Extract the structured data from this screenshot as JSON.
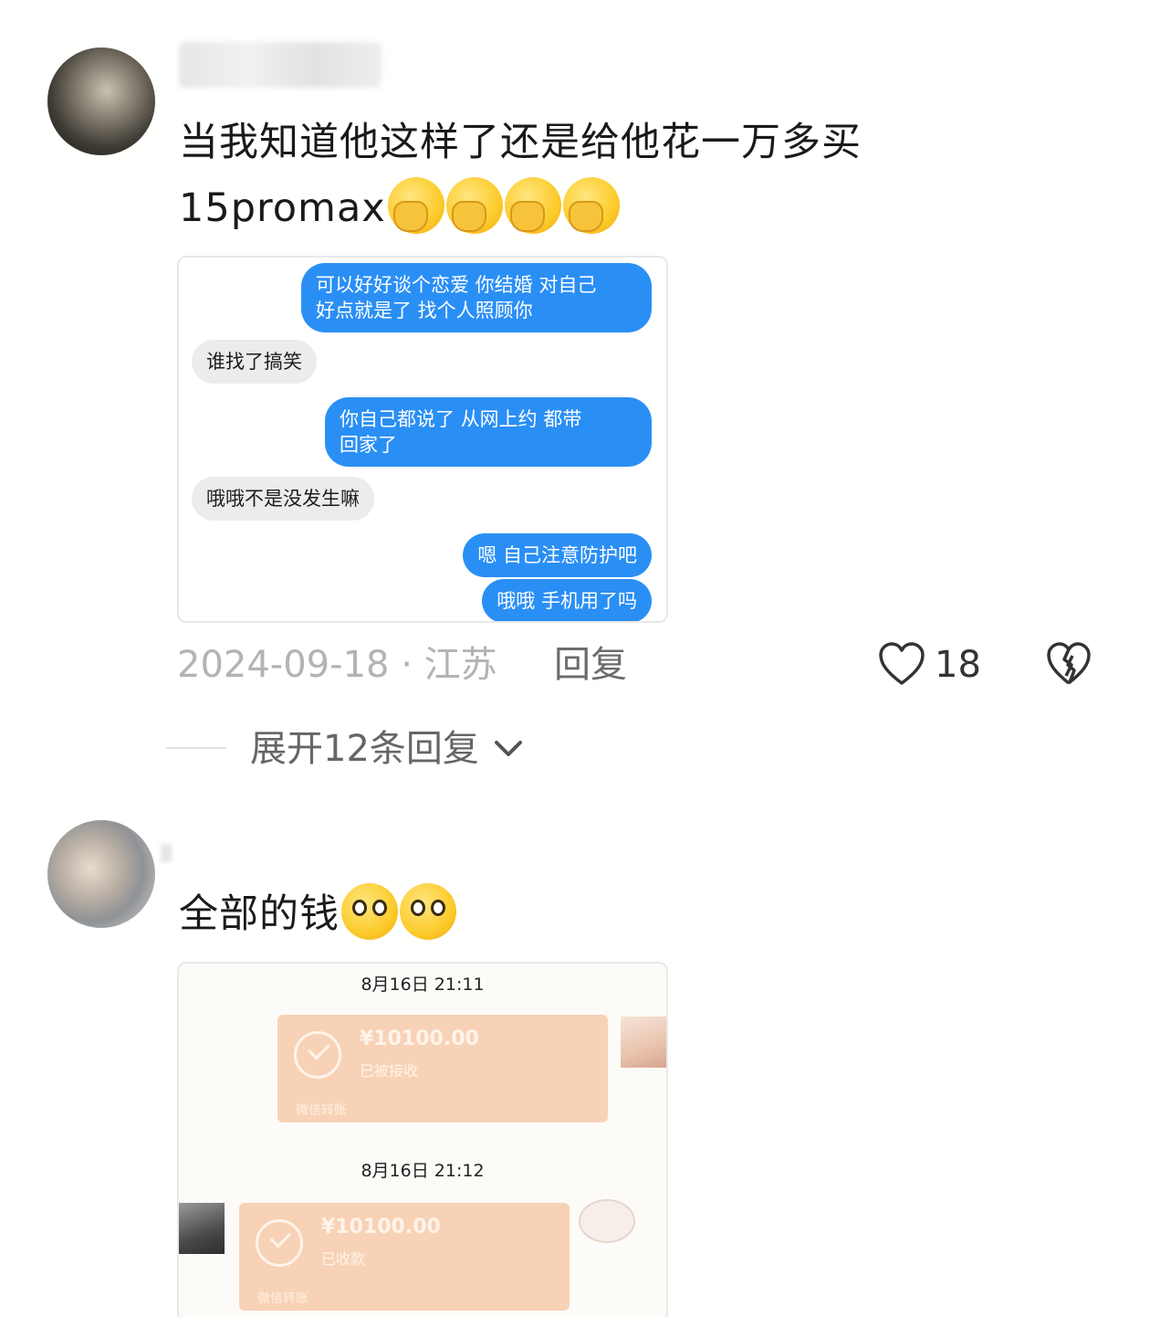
{
  "comments": [
    {
      "text_line1": "当我知道他这样了还是给他花一万多买",
      "text_line2": "15promax",
      "emoji_count": 4,
      "emoji_name": "facepalm-emoji",
      "chat": [
        {
          "side": "me",
          "text": "可以好好谈个恋爱 你结婚 对自己\n好点就是了 找个人照顾你"
        },
        {
          "side": "them",
          "text": "谁找了搞笑"
        },
        {
          "side": "me",
          "text": "你自己都说了 从网上约 都带\n回家了"
        },
        {
          "side": "them",
          "text": "哦哦不是没发生嘛"
        },
        {
          "side": "me",
          "text": "嗯 自己注意防护吧"
        },
        {
          "side": "me",
          "text": "哦哦 手机用了吗"
        }
      ],
      "date": "2024-09-18",
      "separator": "·",
      "location": "江苏",
      "reply_label": "回复",
      "like_count": "18",
      "expand_label": "展开12条回复"
    },
    {
      "text_line1": "全部的钱",
      "emoji_name": "flushed-emoji",
      "transfers": [
        {
          "time": "8月16日 21:11",
          "amount": "¥10100.00",
          "status": "已被接收",
          "foot": "微信转账"
        },
        {
          "time": "8月16日 21:12",
          "amount": "¥10100.00",
          "status": "已收款",
          "foot": "微信转账"
        }
      ]
    }
  ],
  "colors": {
    "bubble_me": "#2a8ff5",
    "bubble_them": "#ececee",
    "transfer": "#f8d2b6"
  }
}
